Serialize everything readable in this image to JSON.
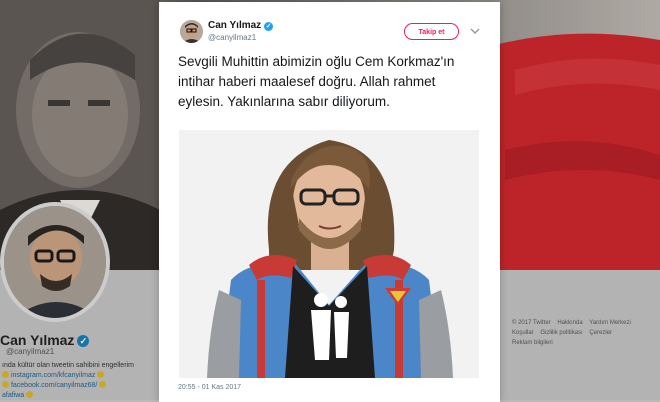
{
  "background_profile": {
    "name": "Can Yılmaz",
    "handle": "@canyilmaz1",
    "bio_lines": [
      "ında kültür olan tweetin sahibini engellerim",
      "instagram.com/kfcanyilmaz",
      "facebook.com/canyilmaz68/",
      "afafiwa"
    ],
    "footer_links": [
      "© 2017 Twitter",
      "Hakkında",
      "Yardım Merkezi",
      "Koşullar",
      "Gizlilik politikası",
      "Çerezler",
      "Reklam bilgileri"
    ]
  },
  "tweet": {
    "author_name": "Can Yılmaz",
    "author_handle": "@canyilmaz1",
    "follow_label": "Takip et",
    "text": "Sevgili Muhittin abimizin oğlu Cem Korkmaz'ın intihar haberi maalesef doğru. Allah rahmet eylesin. Yakınlarına sabır diliyorum.",
    "timestamp": "20:55 - 01 Kas 2017"
  },
  "icons": {
    "verified": "verified-badge-icon",
    "caret": "chevron-down-icon"
  },
  "colors": {
    "follow_accent": "#e0245e",
    "verified_blue": "#1da1f2",
    "flag_red": "#c8262c"
  }
}
